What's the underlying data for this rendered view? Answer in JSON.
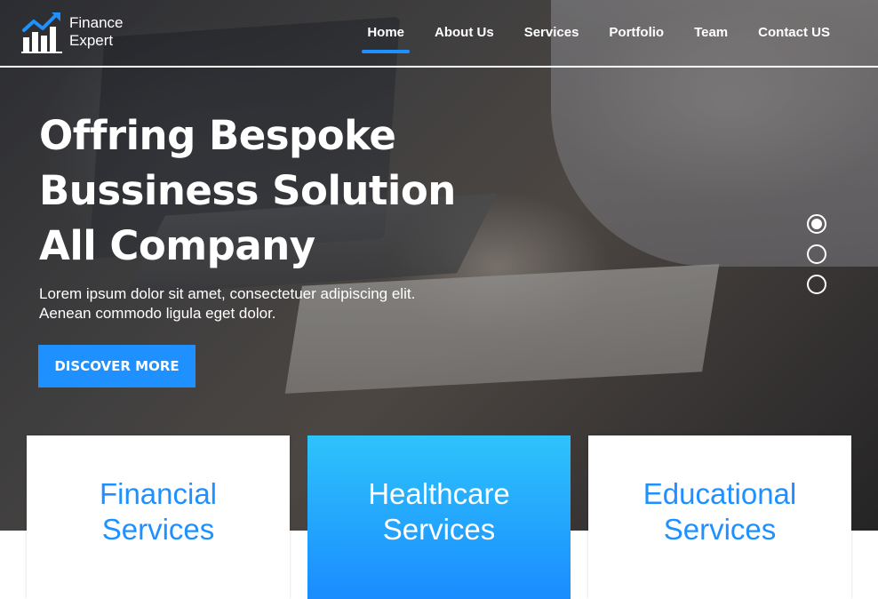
{
  "brand": {
    "logo_icon": "bar-chart-trend-icon",
    "line1": "Finance",
    "line2": "Expert"
  },
  "nav": {
    "items": [
      {
        "label": "Home",
        "active": true
      },
      {
        "label": "About Us"
      },
      {
        "label": "Services"
      },
      {
        "label": "Portfolio"
      },
      {
        "label": "Team"
      },
      {
        "label": "Contact US"
      }
    ]
  },
  "hero": {
    "headline": [
      "Offring Bespoke",
      "Bussiness Solution",
      "All Company"
    ],
    "subtext": [
      "Lorem ipsum dolor sit amet, consectetuer adipiscing elit.",
      "Aenean commodo ligula eget dolor."
    ],
    "cta_label": "DISCOVER MORE",
    "slider": {
      "count": 3,
      "active_index": 0
    }
  },
  "cards": [
    {
      "label": "Financial\nServices",
      "style": "white"
    },
    {
      "label": "Healthcare\nServices",
      "style": "blue"
    },
    {
      "label": "Educational\nServices",
      "style": "white"
    }
  ],
  "colors": {
    "accent": "#1e90ff",
    "card_gradient_top": "#2ec3fb",
    "card_gradient_bottom": "#1a8cff"
  }
}
